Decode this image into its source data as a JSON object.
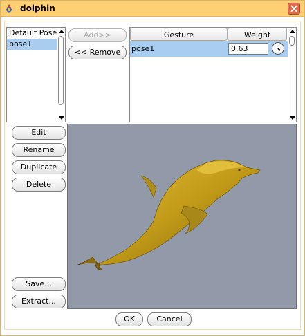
{
  "window": {
    "title": "dolphin"
  },
  "poses": {
    "items": [
      "Default Pose",
      "pose1"
    ],
    "selected_index": 1
  },
  "transfer": {
    "add_label": "Add>>",
    "remove_label": "<< Remove"
  },
  "gestures": {
    "columns": [
      "Gesture",
      "Weight"
    ],
    "rows": [
      {
        "gesture": "pose1",
        "weight": "0.63"
      }
    ]
  },
  "actions": {
    "edit_label": "Edit",
    "rename_label": "Rename",
    "duplicate_label": "Duplicate",
    "delete_label": "Delete",
    "save_label": "Save...",
    "extract_label": "Extract..."
  },
  "footer": {
    "ok_label": "OK",
    "cancel_label": "Cancel"
  },
  "colors": {
    "titlebar": "#ffcf73",
    "selection": "#a9ccf1",
    "viewport_bg": "#9299a9",
    "model": "#c09a18"
  }
}
